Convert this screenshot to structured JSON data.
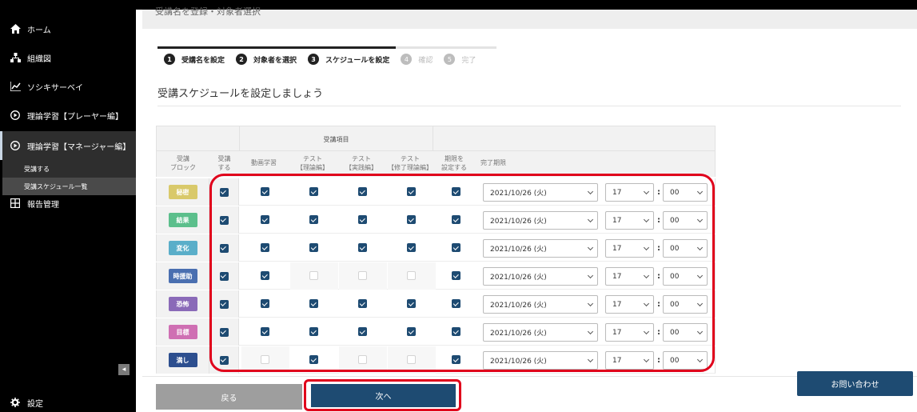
{
  "sidebar": {
    "items": [
      {
        "label": "ホーム",
        "icon": "home-icon"
      },
      {
        "label": "組織図",
        "icon": "org-chart-icon"
      },
      {
        "label": "ソシキサーベイ",
        "icon": "survey-chart-icon"
      },
      {
        "label": "理論学習【プレーヤー編】",
        "icon": "play-circle-icon"
      },
      {
        "label": "理論学習【マネージャー編】",
        "icon": "play-circle-icon"
      },
      {
        "label": "報告管理",
        "icon": "grid-icon"
      }
    ],
    "sub_items": [
      {
        "label": "受講する"
      },
      {
        "label": "受講スケジュール一覧"
      }
    ],
    "settings_label": "設定",
    "collapse_glyph": "◂"
  },
  "header": {
    "clipped_title": "受講名を登録・対象者選択"
  },
  "steps": [
    {
      "num": "1",
      "label": "受講名を設定",
      "done": true
    },
    {
      "num": "2",
      "label": "対象者を選択",
      "done": true
    },
    {
      "num": "3",
      "label": "スケジュールを設定",
      "done": true
    },
    {
      "num": "4",
      "label": "確認",
      "done": false
    },
    {
      "num": "5",
      "label": "完了",
      "done": false
    }
  ],
  "page_title": "受講スケジュールを設定しましょう",
  "table": {
    "group_header": "受講項目",
    "headers": {
      "block": "受講\nブロック",
      "receive": "受講\nする",
      "video": "動画学習",
      "test1": "テスト\n【理論編】",
      "test2": "テスト\n【実践編】",
      "test3": "テスト\n【修了理論編】",
      "deadline_set": "期限を\n設定する",
      "deadline": "完了期限"
    },
    "rows": [
      {
        "block": "秘密",
        "color": "#d9c96a",
        "receive": true,
        "video": true,
        "t1": true,
        "t2": true,
        "t3": true,
        "deadline_set": true,
        "date": "2021/10/26 (火)",
        "hour": "17",
        "minute": "00"
      },
      {
        "block": "結果",
        "color": "#5cbf8c",
        "receive": true,
        "video": true,
        "t1": true,
        "t2": true,
        "t3": true,
        "deadline_set": true,
        "date": "2021/10/26 (火)",
        "hour": "17",
        "minute": "00"
      },
      {
        "block": "変化",
        "color": "#5aaec9",
        "receive": true,
        "video": true,
        "t1": true,
        "t2": true,
        "t3": true,
        "deadline_set": true,
        "date": "2021/10/26 (火)",
        "hour": "17",
        "minute": "00"
      },
      {
        "block": "時援助",
        "color": "#4a6fb0",
        "receive": true,
        "video": true,
        "t1": false,
        "t2": false,
        "t3": false,
        "deadline_set": true,
        "date": "2021/10/26 (火)",
        "hour": "17",
        "minute": "00"
      },
      {
        "block": "恐怖",
        "color": "#8a6ab8",
        "receive": true,
        "video": true,
        "t1": true,
        "t2": true,
        "t3": true,
        "deadline_set": true,
        "date": "2021/10/26 (火)",
        "hour": "17",
        "minute": "00"
      },
      {
        "block": "目標",
        "color": "#cf6fb3",
        "receive": true,
        "video": true,
        "t1": true,
        "t2": true,
        "t3": true,
        "deadline_set": true,
        "date": "2021/10/26 (火)",
        "hour": "17",
        "minute": "00"
      },
      {
        "block": "満し",
        "color": "#2d4f8f",
        "receive": true,
        "video": false,
        "t1": true,
        "t2": false,
        "t3": false,
        "deadline_set": true,
        "date": "2021/10/26 (火)",
        "hour": "17",
        "minute": "00"
      }
    ],
    "colon": ":"
  },
  "buttons": {
    "back": "戻る",
    "next": "次へ",
    "contact": "お問い合わせ"
  },
  "colors": {
    "accent": "#1e4b72",
    "highlight": "#e0001b",
    "sidebar_bg": "#000000"
  }
}
